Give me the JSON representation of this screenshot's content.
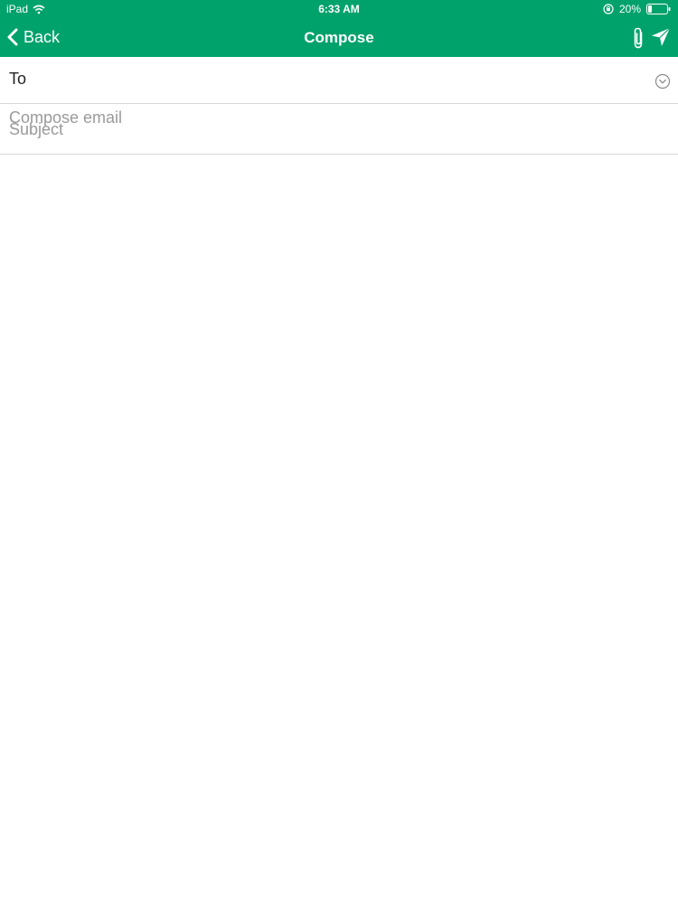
{
  "status_bar": {
    "device": "iPad",
    "time": "6:33 AM",
    "battery_percent": "20%",
    "battery_level": 0.2,
    "icons": [
      "wifi-icon",
      "rotation-lock-icon",
      "battery-icon"
    ]
  },
  "navbar": {
    "back_label": "Back",
    "title": "Compose",
    "icons": [
      "chevron-left-icon",
      "paperclip-icon",
      "send-icon"
    ]
  },
  "form": {
    "to_label": "To",
    "to_value": "",
    "subject_placeholder": "Subject",
    "subject_value": "",
    "body_placeholder": "Compose email",
    "body_value": "",
    "expand_icon": "chevron-down-circle-icon"
  },
  "colors": {
    "accent": "#00a26b",
    "divider": "#d8d8d8",
    "placeholder": "#9a9a9a"
  }
}
